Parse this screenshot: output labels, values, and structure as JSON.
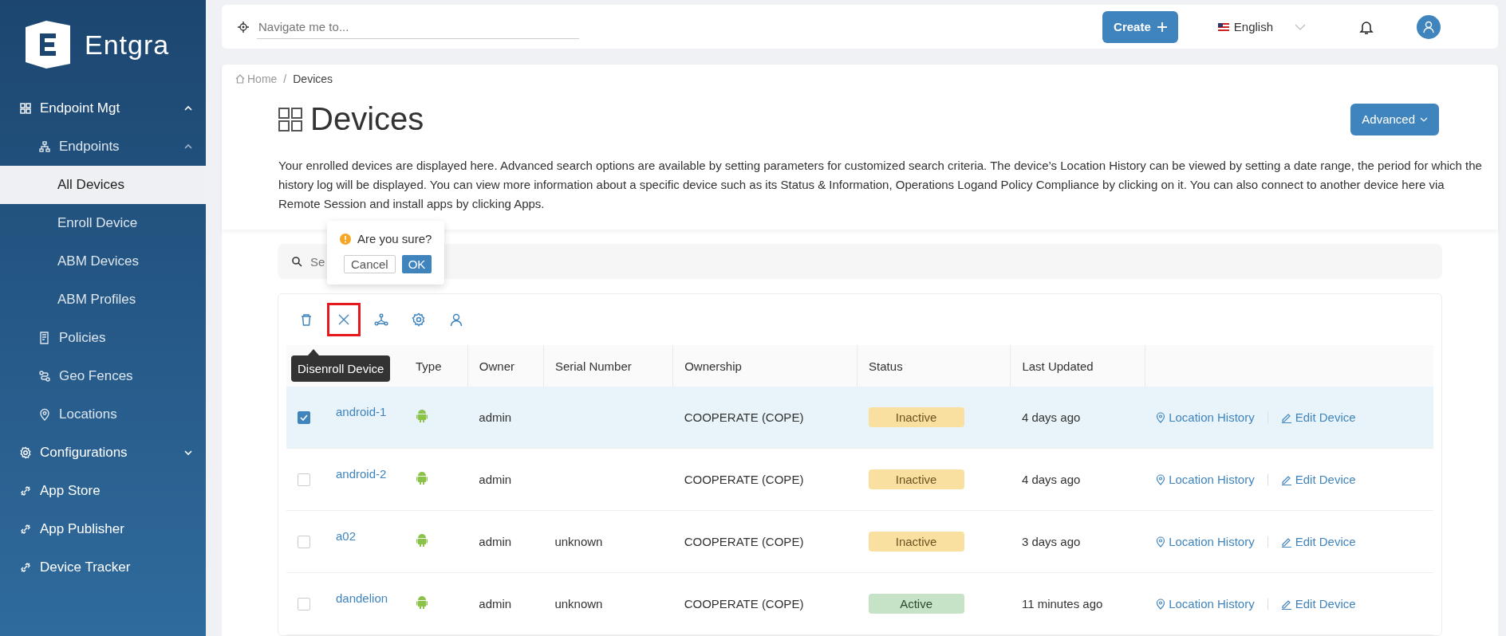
{
  "sidebar": {
    "logo_text": "Entgra",
    "items": [
      {
        "label": "Endpoint Mgt",
        "expanded": true,
        "selected": false,
        "children": [
          {
            "label": "Endpoints",
            "expanded": true,
            "selected": false,
            "children": [
              {
                "label": "All Devices",
                "selected": true
              },
              {
                "label": "Enroll Device",
                "selected": false
              },
              {
                "label": "ABM Devices",
                "selected": false
              },
              {
                "label": "ABM Profiles",
                "selected": false
              }
            ]
          },
          {
            "label": "Policies",
            "selected": false
          },
          {
            "label": "Geo Fences",
            "selected": false
          },
          {
            "label": "Locations",
            "selected": false
          }
        ]
      },
      {
        "label": "Configurations",
        "expanded": false,
        "selected": false
      },
      {
        "label": "App Store",
        "selected": false
      },
      {
        "label": "App Publisher",
        "selected": false
      },
      {
        "label": "Device Tracker",
        "selected": false
      }
    ]
  },
  "topbar": {
    "navigate_placeholder": "Navigate me to...",
    "create_button": "Create",
    "language": "English"
  },
  "breadcrumb": {
    "items": [
      "Home",
      "Devices"
    ],
    "separator": "/"
  },
  "page": {
    "title": "Devices",
    "advanced_button": "Advanced",
    "description": "Your enrolled devices are displayed here. Advanced search options are available by setting parameters for customized search criteria. The device’s Location History can be viewed by setting a date range, the period for which the history log will be displayed. You can view more information about a specific device such as its Status & Information, Operations Logand Policy Compliance by clicking on it. You can also connect to another device here via Remote Session and install apps by clicking Apps."
  },
  "popconfirm": {
    "message": "Are you sure?",
    "buttons": [
      "Cancel",
      "OK"
    ]
  },
  "search": {
    "placeholder": "Se"
  },
  "toolbar": [
    {
      "kind": "delete",
      "highlighted": false
    },
    {
      "kind": "disenroll",
      "highlighted": true
    },
    {
      "kind": "group",
      "highlighted": false
    },
    {
      "kind": "settings",
      "highlighted": false
    },
    {
      "kind": "user",
      "highlighted": false
    }
  ],
  "tooltip": "Disenroll Device",
  "table": {
    "columns": [
      "Type",
      "Owner",
      "Serial Number",
      "Ownership",
      "Status",
      "Last Updated"
    ],
    "rows": [
      {
        "selected": true,
        "device": "android-1",
        "owner": "admin",
        "ownership": "COOPERATE (COPE)",
        "status": {
          "label": "Inactive",
          "kind": "inactive"
        },
        "last_updated": "4 days ago",
        "actions": [
          "Location History",
          "Edit Device"
        ]
      },
      {
        "selected": false,
        "device": "android-2",
        "owner": "admin",
        "ownership": "COOPERATE (COPE)",
        "status": {
          "label": "Inactive",
          "kind": "inactive"
        },
        "last_updated": "4 days ago",
        "actions": [
          "Location History",
          "Edit Device"
        ]
      },
      {
        "selected": false,
        "device": "a02",
        "owner": "admin",
        "serial": "unknown",
        "ownership": "COOPERATE (COPE)",
        "status": {
          "label": "Inactive",
          "kind": "inactive"
        },
        "last_updated": "3 days ago",
        "actions": [
          "Location History",
          "Edit Device"
        ]
      },
      {
        "selected": false,
        "device": "dandelion",
        "owner": "admin",
        "serial": "unknown",
        "ownership": "COOPERATE (COPE)",
        "status": {
          "label": "Active",
          "kind": "active"
        },
        "last_updated": "11 minutes ago",
        "actions": [
          "Location History",
          "Edit Device"
        ]
      }
    ]
  }
}
